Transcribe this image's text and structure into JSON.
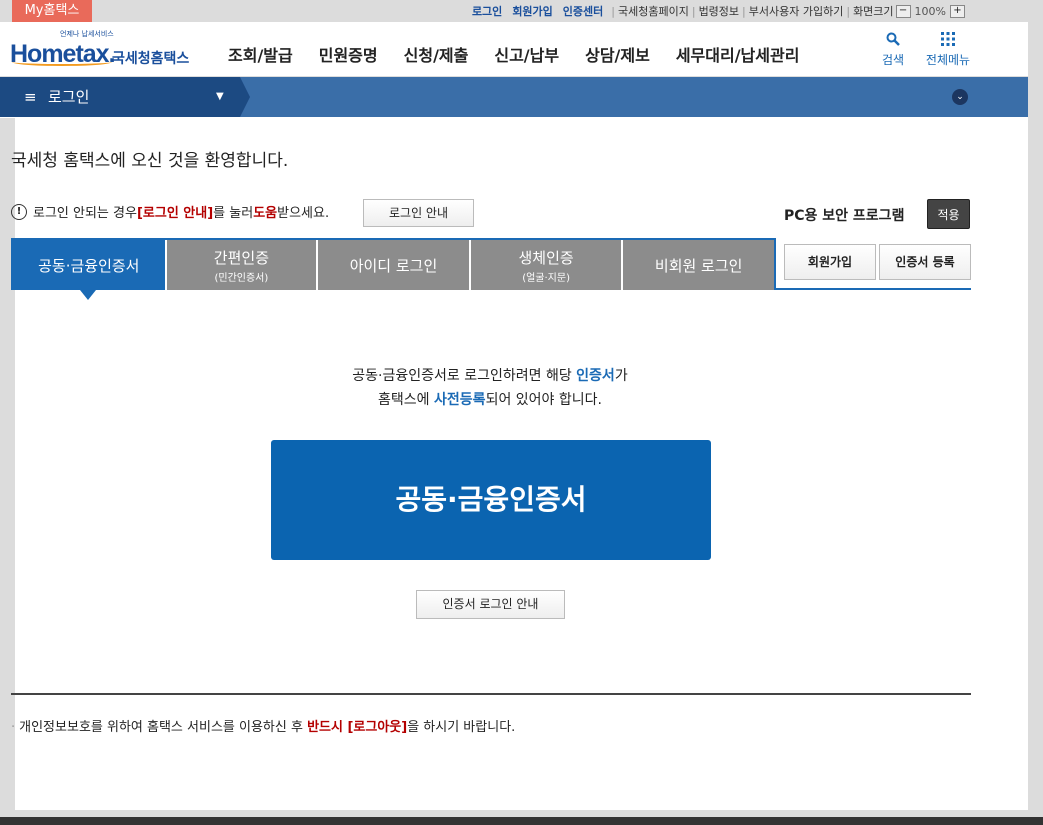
{
  "util": {
    "my_hometax": "My홈택스",
    "links_blue": [
      "로그인",
      "회원가입",
      "인증센터"
    ],
    "links_plain": [
      "국세청홈페이지",
      "법령정보",
      "부서사용자 가입하기",
      "화면크기"
    ],
    "zoom_minus": "−",
    "zoom_value": "100%",
    "zoom_plus": "+"
  },
  "header": {
    "logo_tagline": "언제나 납세서비스",
    "logo_brand": "Hometax.",
    "logo_kr": "국세청홈택스",
    "nav": [
      "조회/발급",
      "민원증명",
      "신청/제출",
      "신고/납부",
      "상담/제보",
      "세무대리/납세관리"
    ],
    "search_icon": "search-icon",
    "search_label": "검색",
    "menu_icon": "grid-icon",
    "menu_label": "전체메뉴"
  },
  "crumb": {
    "menu_glyph": "≡",
    "label": "로그인",
    "caret": "▼",
    "circle": "⌄"
  },
  "welcome": "국세청 홈택스에 오신 것을 환영합니다.",
  "notice": {
    "icon": "!",
    "part1": "로그인 안되는 경우 ",
    "red1": "[로그인 안내]",
    "part2": "를 눌러 ",
    "red2": "도움",
    "part3": "받으세요.",
    "button": "로그인 안내"
  },
  "pc_security": {
    "label": "PC용 보안 프로그램",
    "apply": "적용"
  },
  "tabs": [
    {
      "label": "공동·금융인증서",
      "sub": "",
      "active": true
    },
    {
      "label": "간편인증",
      "sub": "(민간인증서)",
      "active": false
    },
    {
      "label": "아이디 로그인",
      "sub": "",
      "active": false
    },
    {
      "label": "생체인증",
      "sub": "(얼굴·지문)",
      "active": false
    },
    {
      "label": "비회원 로그인",
      "sub": "",
      "active": false
    }
  ],
  "side_buttons": {
    "join": "회원가입",
    "cert_register": "인증서 등록"
  },
  "cert_desc": {
    "line1_a": "공동·금융인증서로 로그인하려면 해당 ",
    "line1_b": "인증서",
    "line1_c": "가",
    "line2_a": "홈택스에 ",
    "line2_b": "사전등록",
    "line2_c": "되어 있어야 합니다."
  },
  "cert_main_button": "공동·금융인증서",
  "cert_guide_button": "인증서 로그인 안내",
  "footer": {
    "dot": "·",
    "part1": "개인정보보호를 위하여 홈택스 서비스를 이용하신 후 ",
    "red": "반드시 [로그아웃]",
    "part2": "을 하시기 바랍니다."
  }
}
